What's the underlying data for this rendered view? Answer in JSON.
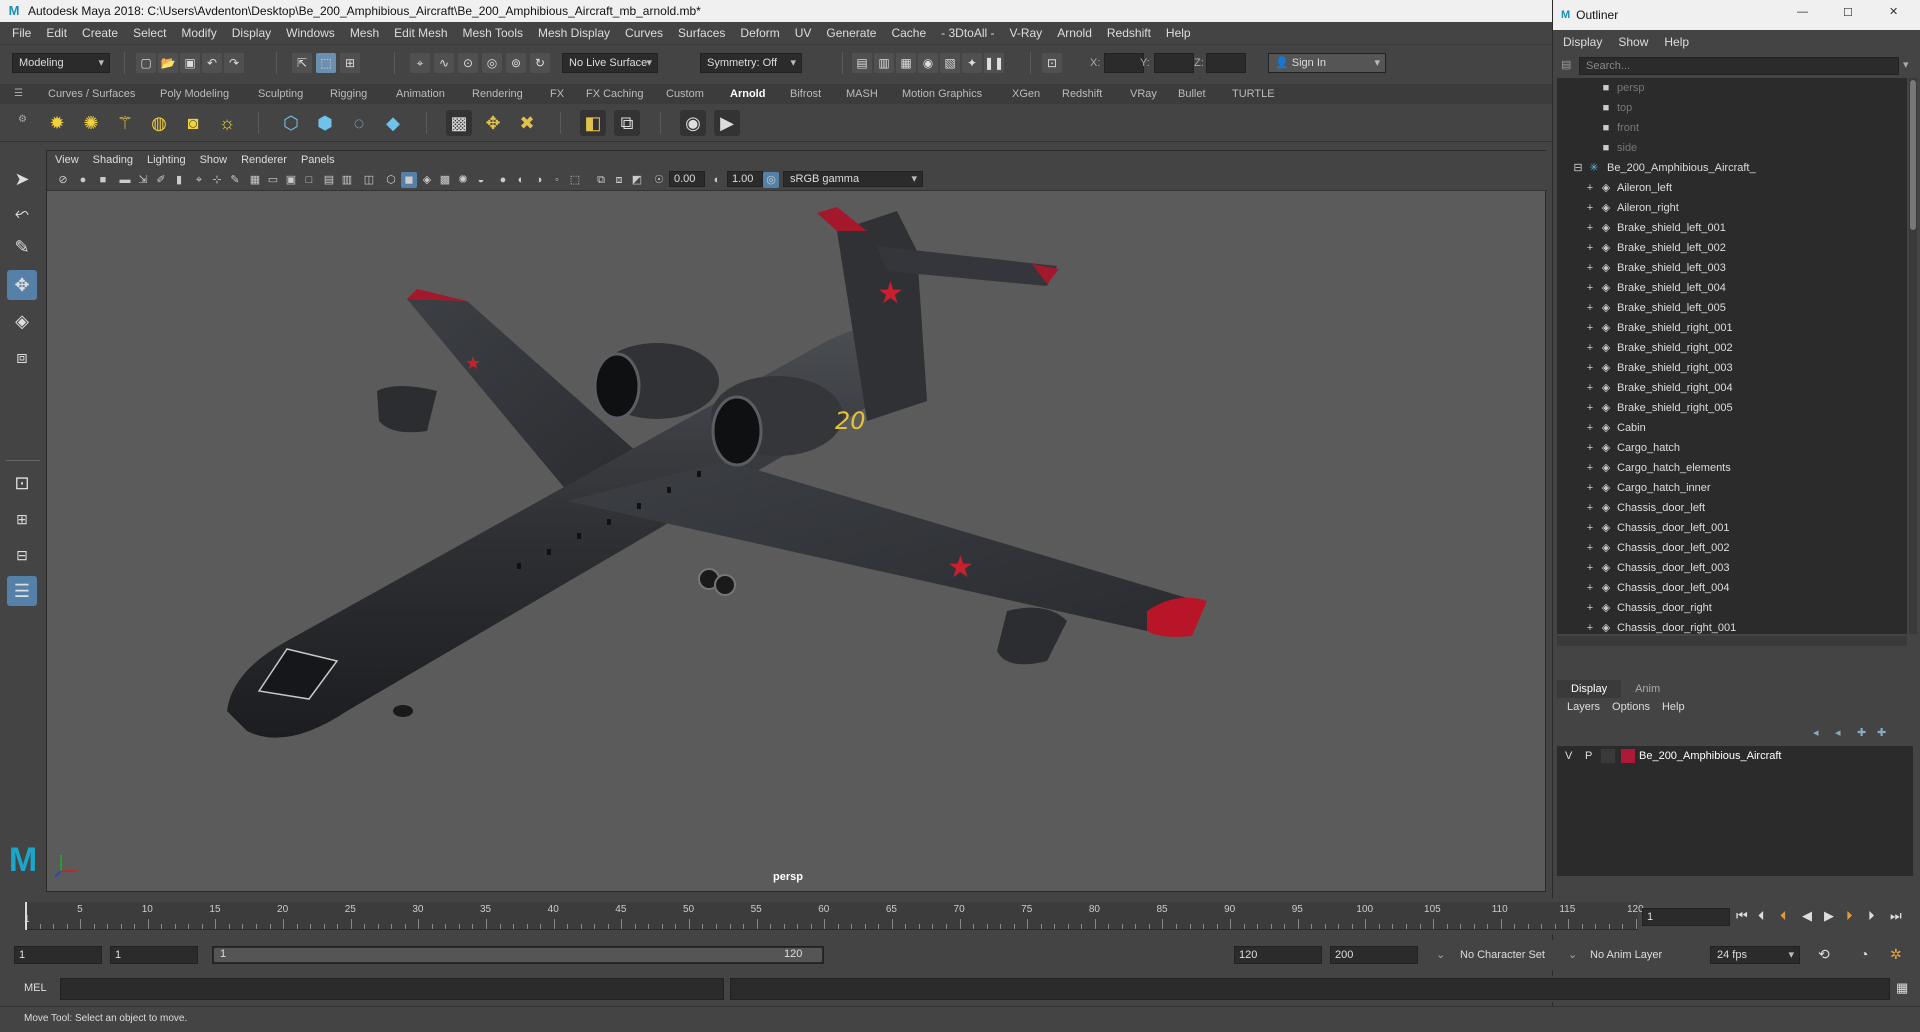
{
  "app": {
    "title": "Autodesk Maya 2018: C:\\Users\\Avdenton\\Desktop\\Be_200_Amphibious_Aircraft\\Be_200_Amphibious_Aircraft_mb_arnold.mb*",
    "logo": "M"
  },
  "menubar": [
    "File",
    "Edit",
    "Create",
    "Select",
    "Modify",
    "Display",
    "Windows",
    "Mesh",
    "Edit Mesh",
    "Mesh Tools",
    "Mesh Display",
    "Curves",
    "Surfaces",
    "Deform",
    "UV",
    "Generate",
    "Cache",
    "- 3DtoAll -",
    "V-Ray",
    "Arnold",
    "Redshift",
    "Help"
  ],
  "statusline": {
    "menuset": "Modeling",
    "live_surface": "No Live Surface",
    "symmetry": "Symmetry: Off",
    "x_label": "X:",
    "y_label": "Y:",
    "z_label": "Z:",
    "sign_in": "Sign In"
  },
  "shelf": {
    "tabs": [
      "Curves / Surfaces",
      "Poly Modeling",
      "Sculpting",
      "Rigging",
      "Animation",
      "Rendering",
      "FX",
      "FX Caching",
      "Custom",
      "Arnold",
      "Bifrost",
      "MASH",
      "Motion Graphics",
      "XGen",
      "Redshift",
      "VRay",
      "Bullet",
      "TURTLE"
    ],
    "active_tab": "Arnold"
  },
  "viewport": {
    "menus": [
      "View",
      "Shading",
      "Lighting",
      "Show",
      "Renderer",
      "Panels"
    ],
    "exposure": "0.00",
    "gamma": "1.00",
    "color_space": "sRGB gamma",
    "camera_label": "persp",
    "tail_number": "20"
  },
  "outliner": {
    "title": "Outliner",
    "menus": [
      "Display",
      "Show",
      "Help"
    ],
    "search_placeholder": "Search...",
    "cameras": [
      "persp",
      "top",
      "front",
      "side"
    ],
    "group": "Be_200_Amphibious_Aircraft_",
    "items": [
      "Aileron_left",
      "Aileron_right",
      "Brake_shield_left_001",
      "Brake_shield_left_002",
      "Brake_shield_left_003",
      "Brake_shield_left_004",
      "Brake_shield_left_005",
      "Brake_shield_right_001",
      "Brake_shield_right_002",
      "Brake_shield_right_003",
      "Brake_shield_right_004",
      "Brake_shield_right_005",
      "Cabin",
      "Cargo_hatch",
      "Cargo_hatch_elements",
      "Cargo_hatch_inner",
      "Chassis_door_left",
      "Chassis_door_left_001",
      "Chassis_door_left_002",
      "Chassis_door_left_003",
      "Chassis_door_left_004",
      "Chassis_door_right",
      "Chassis_door_right_001"
    ]
  },
  "layers": {
    "tabs": [
      "Display",
      "Anim"
    ],
    "menus": [
      "Layers",
      "Options",
      "Help"
    ],
    "layer": {
      "v": "V",
      "p": "P",
      "name": "Be_200_Amphibious_Aircraft",
      "color": "#b0183a"
    }
  },
  "timeline": {
    "ticks": [
      "5",
      "10",
      "15",
      "20",
      "25",
      "30",
      "35",
      "40",
      "45",
      "50",
      "55",
      "60",
      "65",
      "70",
      "75",
      "80",
      "85",
      "90",
      "95",
      "100",
      "105",
      "110",
      "115",
      "120"
    ],
    "first_tick": "1",
    "current_frame": "1"
  },
  "range": {
    "start": "1",
    "anim_start": "1",
    "slider_start": "1",
    "slider_end": "120",
    "end": "120",
    "anim_end": "200",
    "character_set": "No Character Set",
    "anim_layer": "No Anim Layer",
    "fps": "24 fps"
  },
  "cmdline": {
    "lang": "MEL"
  },
  "helpline": "Move Tool: Select an object to move.",
  "colors": {
    "accent": "#5580a8",
    "layer_color": "#b0183a"
  }
}
